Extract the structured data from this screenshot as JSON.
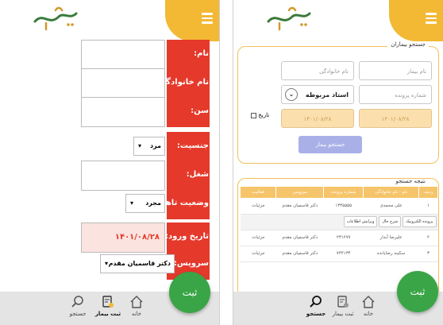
{
  "left_screen": {
    "form": [
      {
        "label": "نام:",
        "value": ""
      },
      {
        "label": "نام خانوادگی:",
        "value": ""
      },
      {
        "label": "سن:",
        "value": ""
      },
      {
        "label": "جنسیت:",
        "value": "مرد"
      },
      {
        "label": "شغل:",
        "value": ""
      },
      {
        "label": "وضعیت تاهل:",
        "value": "مجرد"
      },
      {
        "label": "تاریخ ورود:",
        "value": "۱۴۰۱/۰۸/۲۸"
      },
      {
        "label": "سرویس:",
        "value": "دکتر قاسمیان مقدم"
      }
    ],
    "fab_label": "ثبت",
    "bottom_nav": [
      {
        "label": "جستجو",
        "icon": "search-icon"
      },
      {
        "label": "ثبت بیمار",
        "icon": "register-patient-icon",
        "active": true
      },
      {
        "label": "خانه",
        "icon": "home-icon"
      }
    ]
  },
  "right_screen": {
    "search_panel": {
      "title": "جستجو بیماران",
      "first_name_placeholder": "نام بیمار",
      "last_name_placeholder": "نام خانوادگی",
      "file_number_placeholder": "شماره پرونده",
      "professor_select": "استاد مربوطه",
      "date_checkbox_label": "تاریخ",
      "date_from": "۱۴۰۱/۰۸/۲۸",
      "date_to": "۱۴۰۱/۰۸/۲۸",
      "search_button": "جستجو بیمار"
    },
    "results_panel": {
      "title": "نتیجه جستجو",
      "columns": [
        "ردیف",
        "نام - نام خانوادگی",
        "شماره پرونده",
        "سرویس",
        "فعالیت"
      ],
      "rows": [
        {
          "index": "۱",
          "name": "علی محمدی",
          "file": "۱۳۴۵۵۵۵",
          "service": "دکتر قاسمیان مقدم",
          "action": "جزئیات"
        },
        {
          "index": "۲",
          "name": "علیرضا آبدار",
          "file": "۲۳۱۲۷۷",
          "service": "دکتر قاسمیان مقدم",
          "action": "جزئیات"
        },
        {
          "index": "۳",
          "name": "سکینه رضایانده",
          "file": "۷۴۴۱۳۴",
          "service": "دکتر قاسمیان مقدم",
          "action": "جزئیات"
        }
      ],
      "row_actions": [
        "پرونده الکترونیک",
        "شرح حال",
        "ویرایش اطلاعات"
      ]
    },
    "fab_label": "ثبت",
    "bottom_nav": [
      {
        "label": "جستجو",
        "icon": "search-icon",
        "active": true
      },
      {
        "label": "ثبت بیمار",
        "icon": "register-patient-icon"
      },
      {
        "label": "خانه",
        "icon": "home-icon"
      }
    ]
  },
  "colors": {
    "accent": "#f3b834",
    "label_red": "#e5392b",
    "fab_green": "#3aa547",
    "search_button": "#a9b0e8"
  }
}
